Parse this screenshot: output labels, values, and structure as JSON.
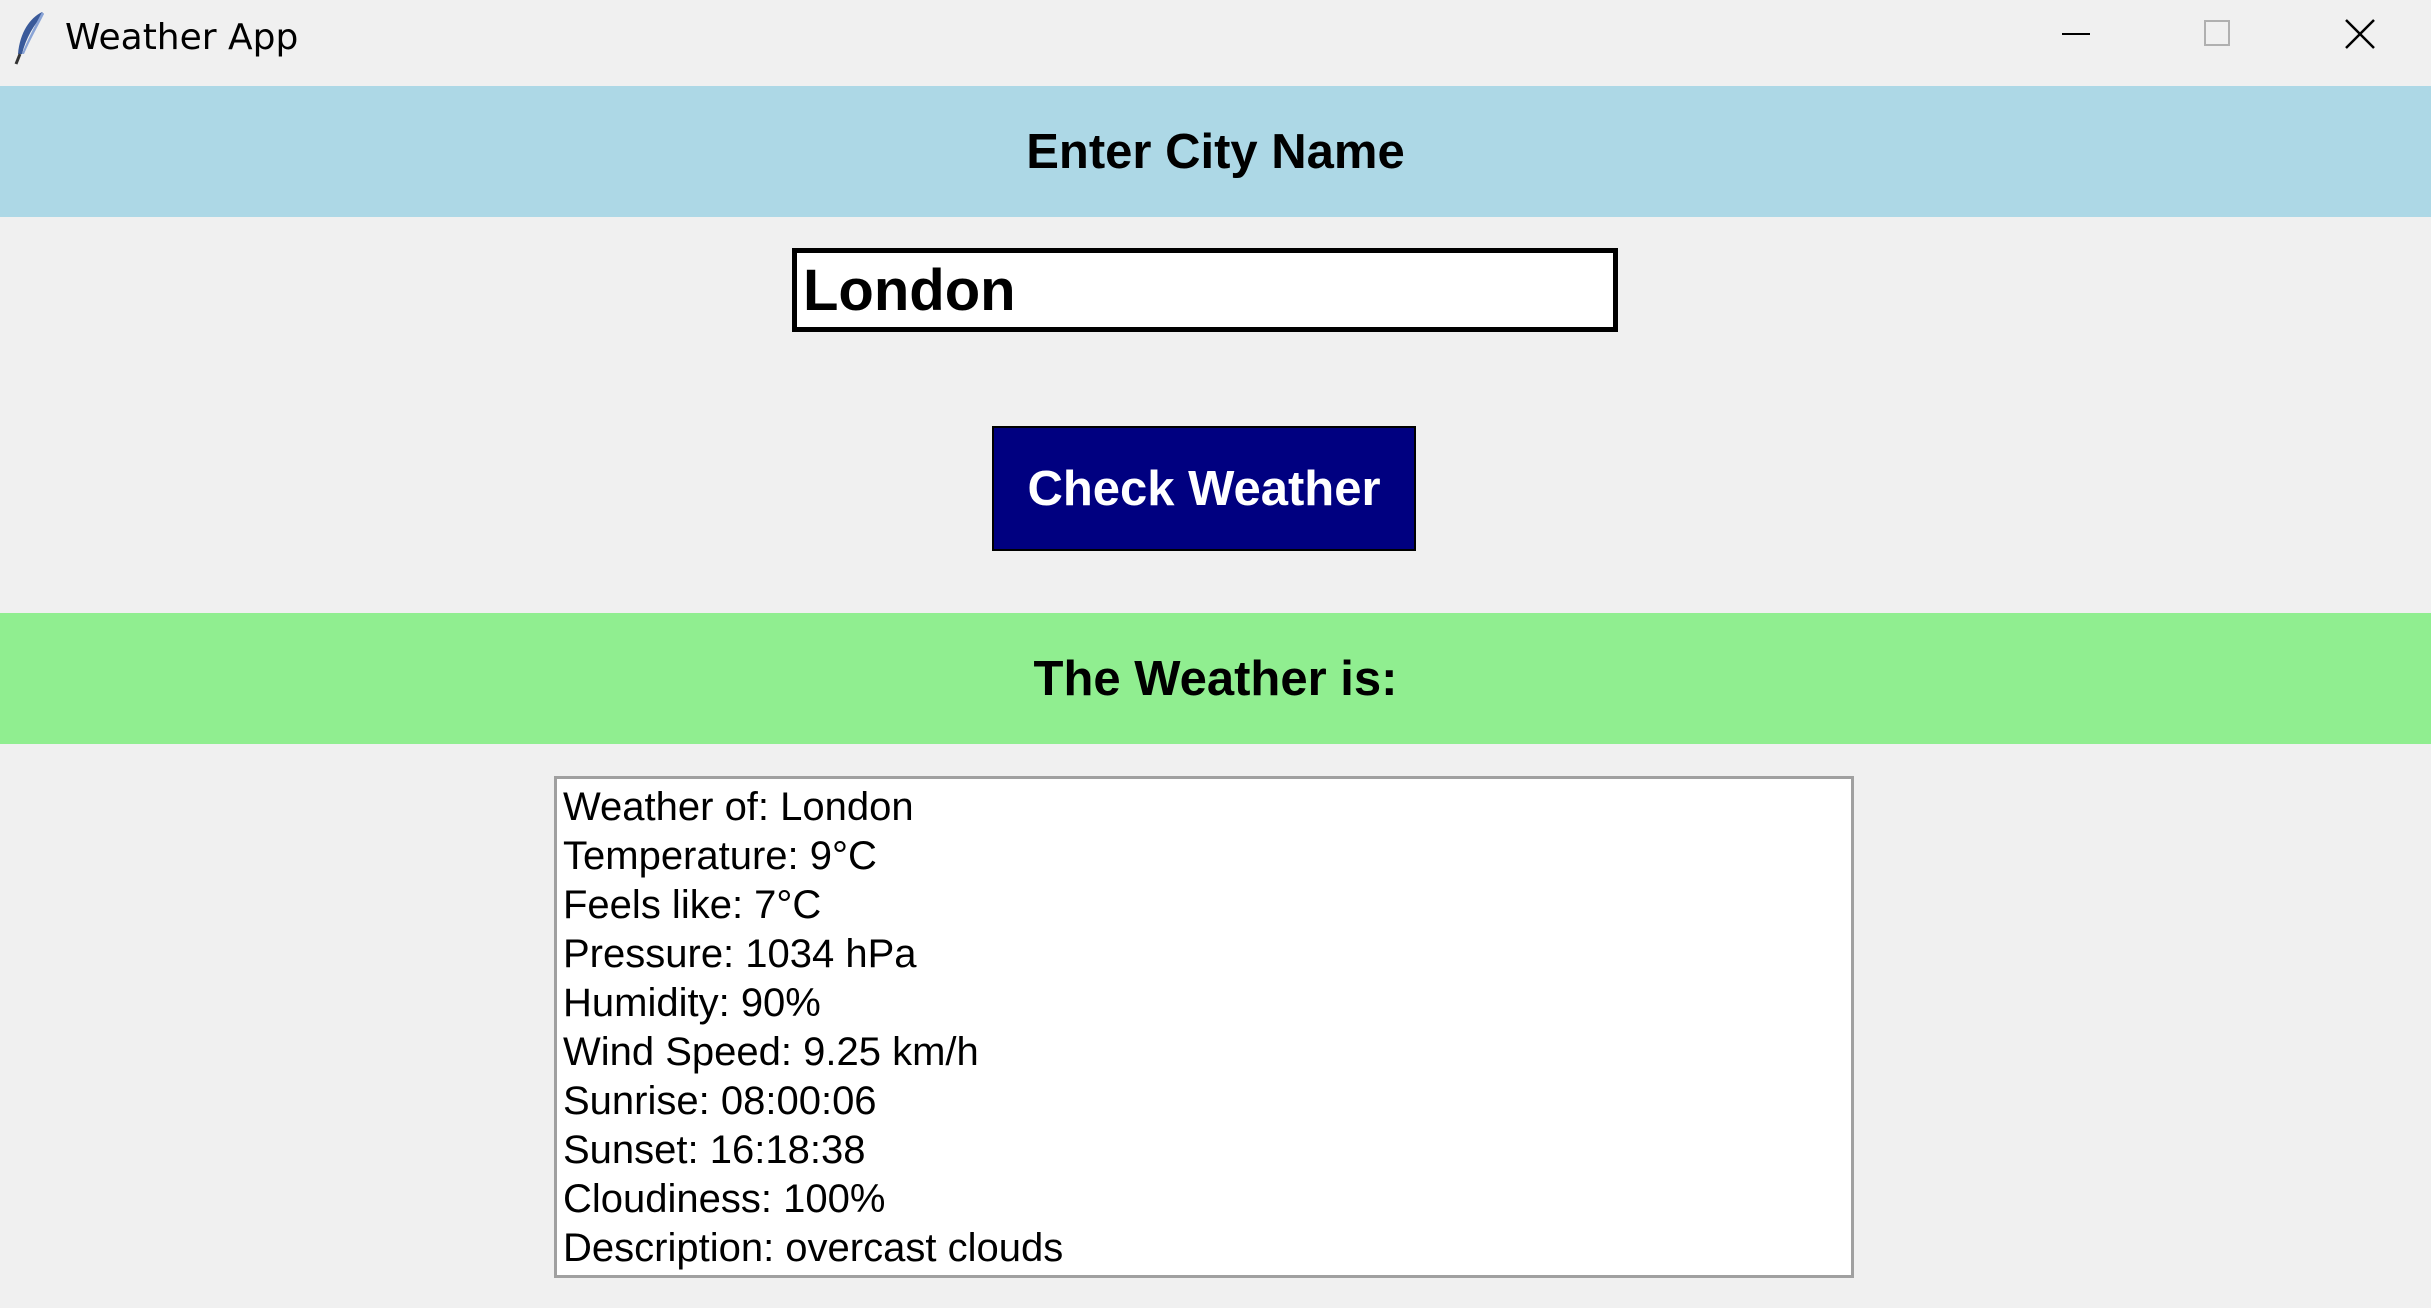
{
  "window": {
    "title": "Weather App",
    "minimize_icon": "minimize-icon",
    "maximize_icon": "maximize-icon",
    "close_icon": "close-icon",
    "app_icon": "feather-icon"
  },
  "input_section": {
    "heading": "Enter City Name",
    "heading_bg": "#add8e6",
    "city_value": "London"
  },
  "action": {
    "check_label": "Check Weather",
    "button_bg": "#000080",
    "button_fg": "#ffffff"
  },
  "output_section": {
    "heading": "The Weather is:",
    "heading_bg": "#90ee90",
    "lines": [
      "Weather of: London",
      "Temperature: 9°C",
      "Feels like: 7°C",
      "Pressure: 1034 hPa",
      "Humidity: 90%",
      "Wind Speed: 9.25 km/h",
      "Sunrise: 08:00:06",
      "Sunset: 16:18:38",
      "Cloudiness: 100%",
      "Description: overcast clouds"
    ]
  }
}
